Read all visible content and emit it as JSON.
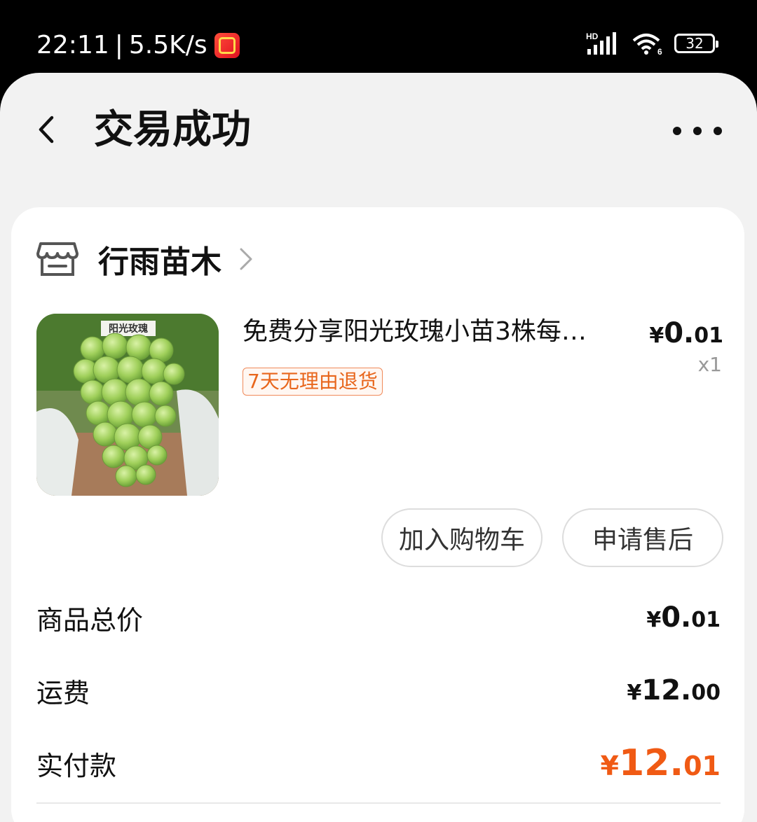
{
  "status_bar": {
    "time": "22:11",
    "separator": "|",
    "net_speed": "5.5K/s",
    "app_badge_icon": "taobao-618-icon",
    "signal_label": "HD",
    "wifi_label": "6",
    "battery": "32"
  },
  "header": {
    "title": "交易成功",
    "back_icon": "chevron-left-icon",
    "more_icon": "more-horizontal-icon"
  },
  "shop": {
    "name": "行雨苗木",
    "icon": "store-icon"
  },
  "product": {
    "image_label": "阳光玫瑰",
    "title": "免费分享阳光玫瑰小苗3株每…",
    "tag": "7天无理由退货",
    "price": {
      "currency": "¥",
      "int": "0.",
      "dec": "01"
    },
    "quantity": "x1"
  },
  "actions": {
    "add_to_cart": "加入购物车",
    "after_sale": "申请售后"
  },
  "summary": {
    "goods_total_label": "商品总价",
    "goods_total": {
      "currency": "¥",
      "int": "0.",
      "dec": "01"
    },
    "shipping_label": "运费",
    "shipping": {
      "currency": "¥",
      "int": "12.",
      "dec": "00"
    },
    "paid_label": "实付款",
    "paid": {
      "currency": "¥",
      "int": "12.",
      "dec": "01"
    }
  },
  "colors": {
    "accent": "#f05a14",
    "tag_text": "#e8661c",
    "background": "#f2f2f2"
  }
}
